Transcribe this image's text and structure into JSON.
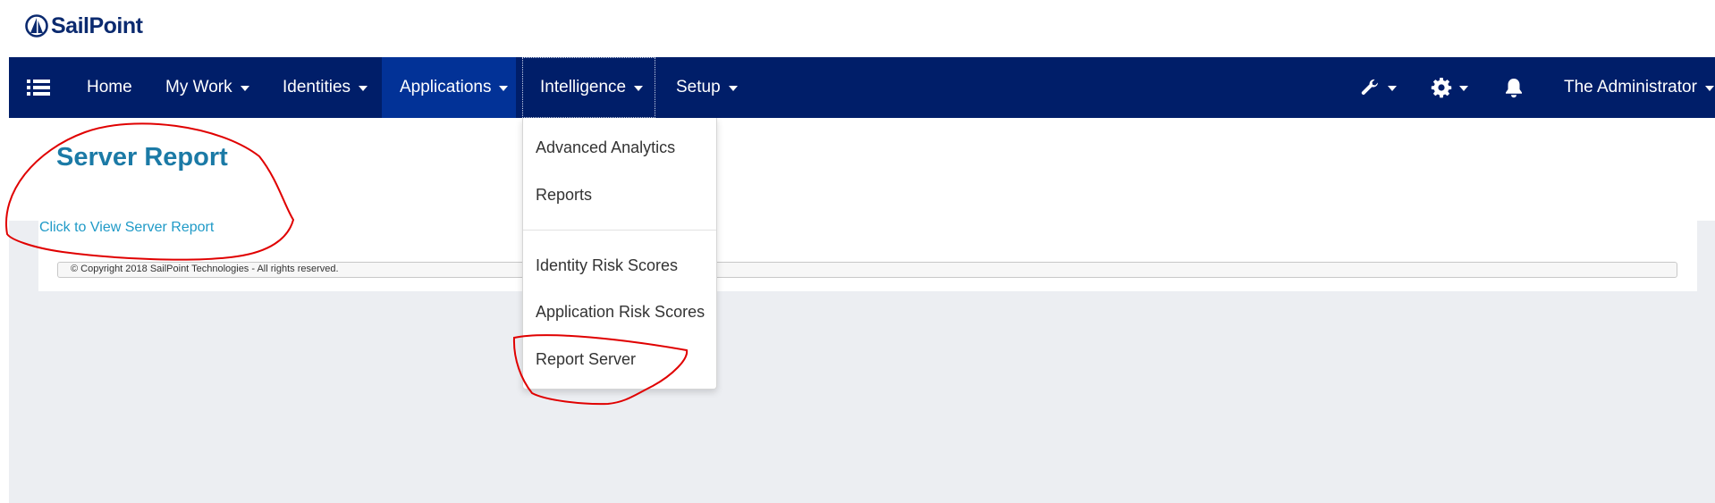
{
  "brand": {
    "name": "SailPoint"
  },
  "nav": {
    "items": [
      {
        "label": "Home"
      },
      {
        "label": "My Work"
      },
      {
        "label": "Identities"
      },
      {
        "label": "Applications"
      },
      {
        "label": "Intelligence"
      },
      {
        "label": "Setup"
      }
    ],
    "user_label": "The Administrator",
    "icons": [
      "menu-icon",
      "wrench-icon",
      "gear-icon",
      "bell-icon"
    ]
  },
  "intelligence_menu": {
    "group1": [
      "Advanced Analytics",
      "Reports"
    ],
    "group2": [
      "Identity Risk Scores",
      "Application Risk Scores",
      "Report Server"
    ]
  },
  "page": {
    "title": "Server Report",
    "link": "Click to View Server Report",
    "copyright": "© Copyright 2018 SailPoint Technologies - All rights reserved."
  },
  "colors": {
    "navbar": "#001e69",
    "nav_active": "#023297",
    "title": "#1b7aa6",
    "link": "#1f9ac7",
    "annotation": "#e00000"
  }
}
